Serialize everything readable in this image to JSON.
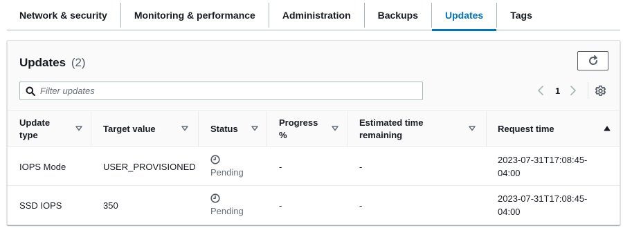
{
  "tabs": [
    {
      "label": "Network & security",
      "active": false
    },
    {
      "label": "Monitoring & performance",
      "active": false
    },
    {
      "label": "Administration",
      "active": false
    },
    {
      "label": "Backups",
      "active": false
    },
    {
      "label": "Updates",
      "active": true
    },
    {
      "label": "Tags",
      "active": false
    }
  ],
  "panel": {
    "title": "Updates",
    "count": "(2)",
    "refresh_icon": "refresh-icon"
  },
  "filter": {
    "placeholder": "Filter updates",
    "value": "",
    "icon": "search-icon"
  },
  "pagination": {
    "current_page": "1",
    "prev_icon": "chevron-left-icon",
    "next_icon": "chevron-right-icon",
    "settings_icon": "gear-icon"
  },
  "table": {
    "columns": [
      {
        "label": "Update type",
        "sort": "none"
      },
      {
        "label": "Target value",
        "sort": "none"
      },
      {
        "label": "Status",
        "sort": "none"
      },
      {
        "label": "Progress %",
        "sort": "none"
      },
      {
        "label": "Estimated time remaining",
        "sort": "none"
      },
      {
        "label": "Request time",
        "sort": "ascending"
      }
    ],
    "rows": [
      {
        "update_type": "IOPS Mode",
        "target_value": "USER_PROVISIONED",
        "status": "Pending",
        "status_icon": "clock-icon",
        "progress": "-",
        "estimated_time": "-",
        "request_time": "2023-07-31T17:08:45-04:00"
      },
      {
        "update_type": "SSD IOPS",
        "target_value": "350",
        "status": "Pending",
        "status_icon": "clock-icon",
        "progress": "-",
        "estimated_time": "-",
        "request_time": "2023-07-31T17:08:45-04:00"
      }
    ]
  },
  "colors": {
    "accent": "#0073bb",
    "text": "#16191f",
    "muted": "#687078",
    "border": "#aab7b8"
  }
}
